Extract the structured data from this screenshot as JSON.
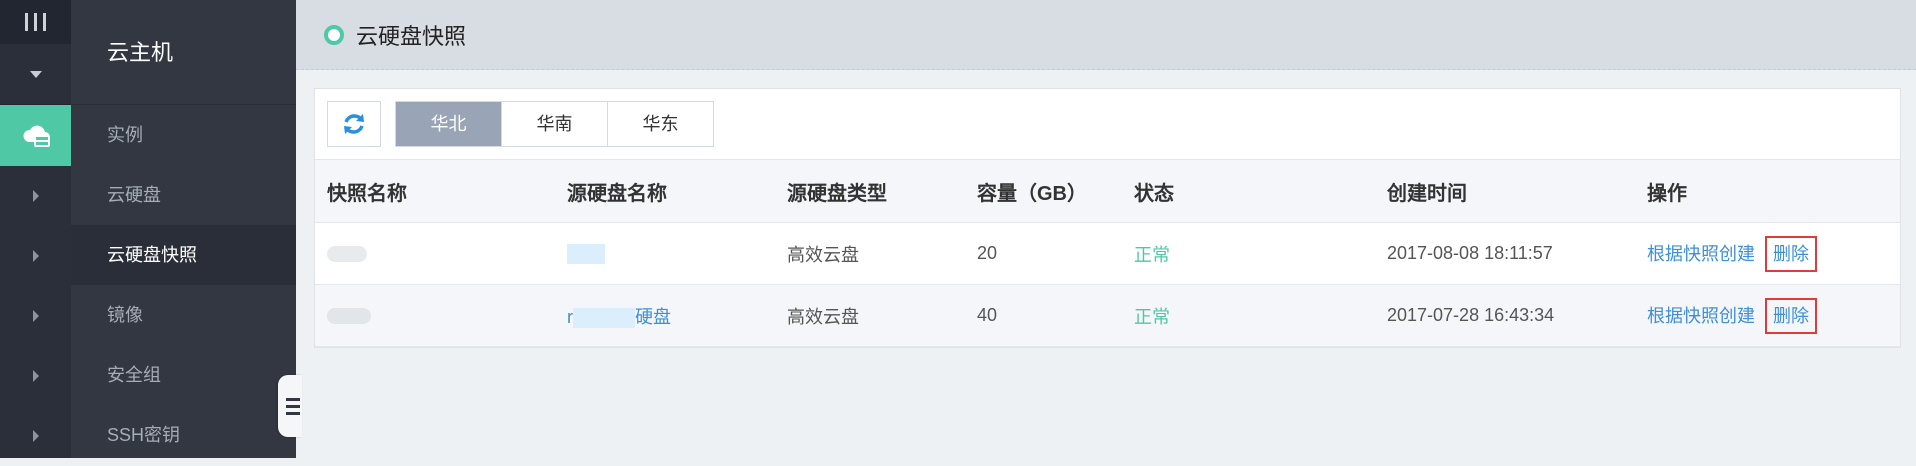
{
  "sidebar": {
    "section_title": "云主机",
    "items": [
      {
        "label": "实例"
      },
      {
        "label": "云硬盘"
      },
      {
        "label": "云硬盘快照"
      },
      {
        "label": "镜像"
      },
      {
        "label": "安全组"
      },
      {
        "label": "SSH密钥"
      }
    ]
  },
  "header": {
    "title": "云硬盘快照"
  },
  "regions": {
    "tabs": [
      "华北",
      "华南",
      "华东"
    ],
    "selected": "华北"
  },
  "table": {
    "columns": [
      "快照名称",
      "源硬盘名称",
      "源硬盘类型",
      "容量（GB）",
      "状态",
      "创建时间",
      "操作"
    ],
    "rows": [
      {
        "disk_type": "高效云盘",
        "capacity": "20",
        "status": "正常",
        "created": "2017-08-08 18:11:57",
        "create_action": "根据快照创建",
        "delete_action": "删除",
        "source_prefix": "",
        "source_suffix": ""
      },
      {
        "disk_type": "高效云盘",
        "capacity": "40",
        "status": "正常",
        "created": "2017-07-28 16:43:34",
        "create_action": "根据快照创建",
        "delete_action": "删除",
        "source_prefix": "r",
        "source_suffix": "硬盘"
      }
    ]
  },
  "colors": {
    "accent": "#4fc8a6",
    "sidebar_bg": "#333742",
    "rail_bg": "#2b2f3a",
    "link": "#3d8fd8",
    "delete_border": "#e03a3a",
    "tab_active": "#9aa4b7"
  },
  "icons": [
    "menu-icon",
    "collapse-icon",
    "cloud-server-icon",
    "expand-arrow-icon",
    "refresh-icon",
    "title-ring-icon"
  ]
}
